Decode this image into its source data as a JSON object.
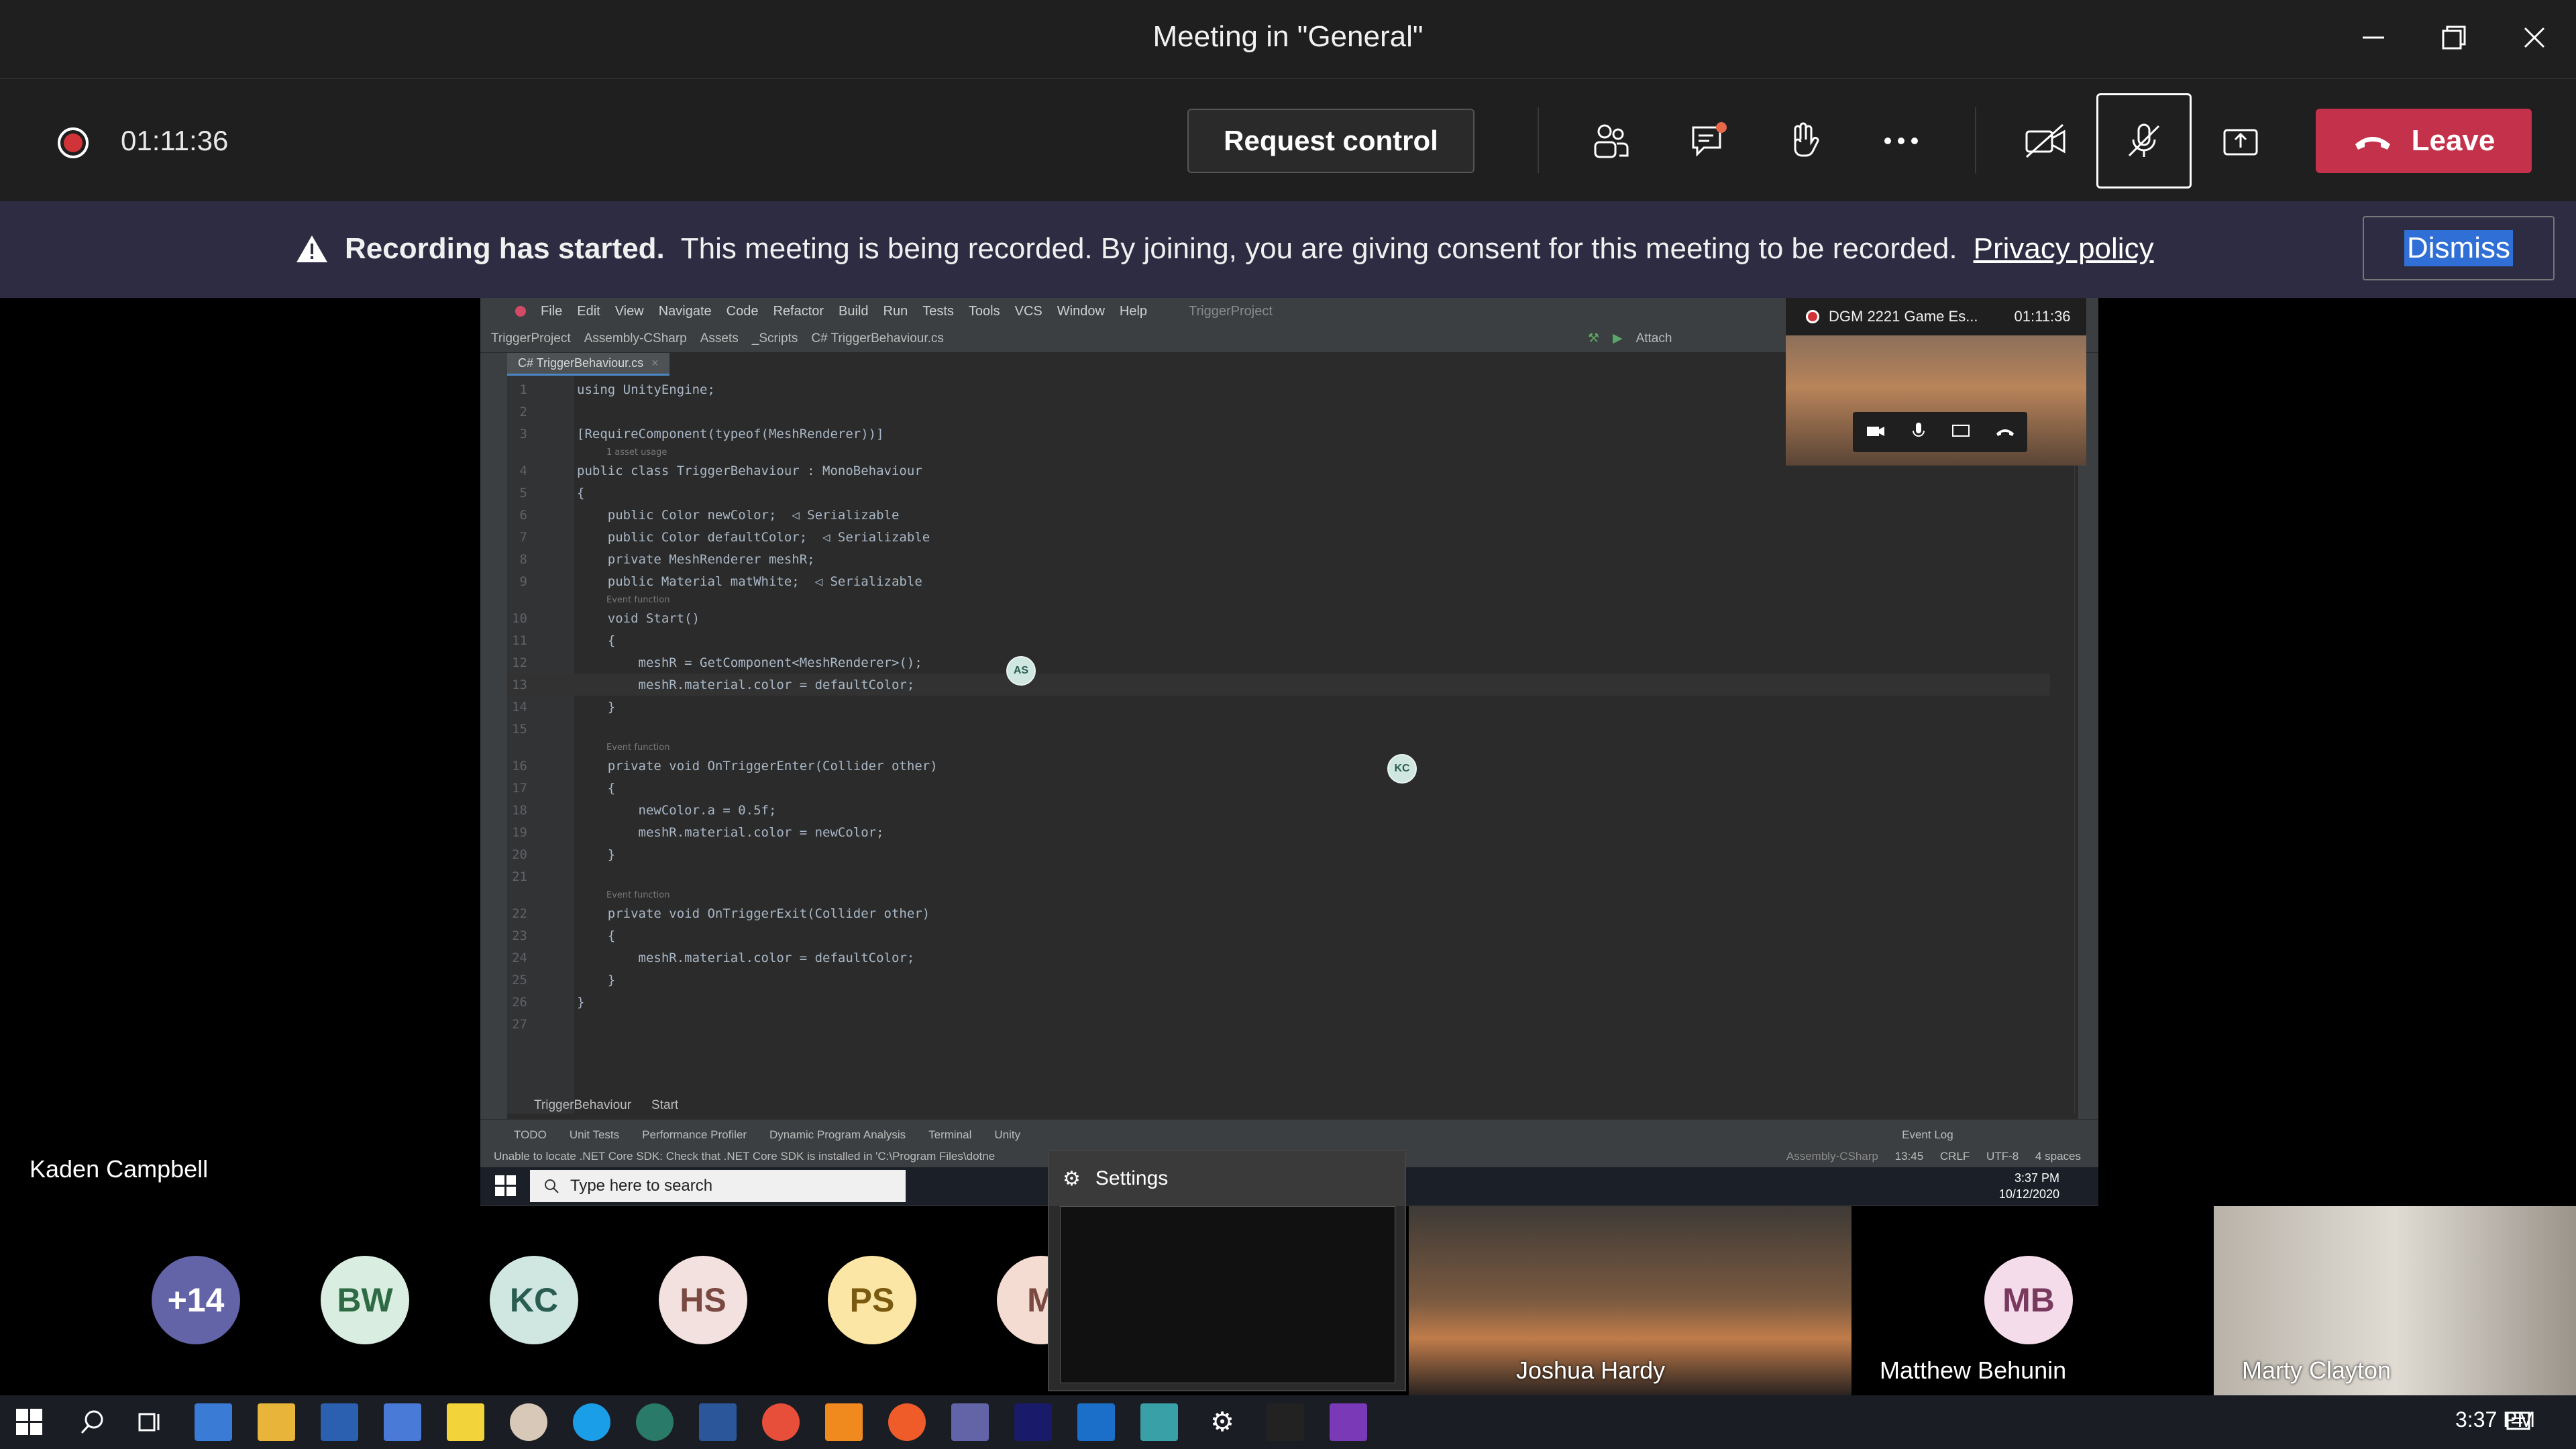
{
  "window": {
    "title": "Meeting in \"General\""
  },
  "toolbar": {
    "timer": "01:11:36",
    "request_control": "Request control",
    "leave": "Leave"
  },
  "banner": {
    "heading": "Recording has started.",
    "message": "This meeting is being recorded. By joining, you are giving consent for this meeting to be recorded.",
    "link": "Privacy policy",
    "dismiss": "Dismiss"
  },
  "ide": {
    "menu": [
      "File",
      "Edit",
      "View",
      "Navigate",
      "Code",
      "Refactor",
      "Build",
      "Run",
      "Tests",
      "Tools",
      "VCS",
      "Window",
      "Help"
    ],
    "project": "TriggerProject",
    "breadcrumb": [
      "TriggerProject",
      "Assembly-CSharp",
      "Assets",
      "_Scripts",
      "C# TriggerBehaviour.cs"
    ],
    "attach": "Attach",
    "tab": "C# TriggerBehaviour.cs",
    "code": [
      {
        "ln": "1",
        "text": "using UnityEngine;"
      },
      {
        "ln": "2",
        "text": ""
      },
      {
        "ln": "3",
        "text": "[RequireComponent(typeof(MeshRenderer))]"
      },
      {
        "hint": "1 asset usage"
      },
      {
        "ln": "4",
        "text": "public class TriggerBehaviour : MonoBehaviour"
      },
      {
        "ln": "5",
        "text": "{"
      },
      {
        "ln": "6",
        "text": "    public Color newColor;  ◁ Serializable"
      },
      {
        "ln": "7",
        "text": "    public Color defaultColor;  ◁ Serializable"
      },
      {
        "ln": "8",
        "text": "    private MeshRenderer meshR;"
      },
      {
        "ln": "9",
        "text": "    public Material matWhite;  ◁ Serializable"
      },
      {
        "hint": "Event function"
      },
      {
        "ln": "10",
        "text": "    void Start()"
      },
      {
        "ln": "11",
        "text": "    {"
      },
      {
        "ln": "12",
        "text": "        meshR = GetComponent<MeshRenderer>();"
      },
      {
        "ln": "13",
        "text": "        meshR.material.color = defaultColor;",
        "current": true
      },
      {
        "ln": "14",
        "text": "    }"
      },
      {
        "ln": "15",
        "text": ""
      },
      {
        "hint": "Event function"
      },
      {
        "ln": "16",
        "text": "    private void OnTriggerEnter(Collider other)"
      },
      {
        "ln": "17",
        "text": "    {"
      },
      {
        "ln": "18",
        "text": "        newColor.a = 0.5f;"
      },
      {
        "ln": "19",
        "text": "        meshR.material.color = newColor;"
      },
      {
        "ln": "20",
        "text": "    }"
      },
      {
        "ln": "21",
        "text": ""
      },
      {
        "hint": "Event function"
      },
      {
        "ln": "22",
        "text": "    private void OnTriggerExit(Collider other)"
      },
      {
        "ln": "23",
        "text": "    {"
      },
      {
        "ln": "24",
        "text": "        meshR.material.color = defaultColor;"
      },
      {
        "ln": "25",
        "text": "    }"
      },
      {
        "ln": "26",
        "text": "}"
      },
      {
        "ln": "27",
        "text": ""
      }
    ],
    "structure": [
      "TriggerBehaviour",
      "Start"
    ],
    "tool_tabs": [
      "TODO",
      "Unit Tests",
      "Performance Profiler",
      "Dynamic Program Analysis",
      "Terminal",
      "Unity"
    ],
    "event_log": "Event Log",
    "status": "Unable to locate .NET Core SDK: Check that .NET Core SDK is installed in 'C:\\Program Files\\dotne",
    "status_right": [
      "Assembly-CSharp",
      "13:45",
      "CRLF",
      "UTF-8",
      "4 spaces"
    ],
    "cursors": [
      "AS",
      "KC"
    ]
  },
  "mini_call": {
    "title": "DGM 2221 Game Es...",
    "timer": "01:11:36"
  },
  "inner_taskbar": {
    "search_placeholder": "Type here to search",
    "time": "3:37 PM",
    "date": "10/12/2020"
  },
  "settings_popup": {
    "title": "Settings"
  },
  "presenter": "Kaden Campbell",
  "gallery": {
    "avatars": [
      {
        "initials": "+14",
        "bg": "#6264a7",
        "fg": "#ffffff"
      },
      {
        "initials": "BW",
        "bg": "#d9eee0",
        "fg": "#2e6b45"
      },
      {
        "initials": "KC",
        "bg": "#cfe7e0",
        "fg": "#2a5d50"
      },
      {
        "initials": "HS",
        "bg": "#f2e1de",
        "fg": "#7a4a42"
      },
      {
        "initials": "PS",
        "bg": "#fbe6a6",
        "fg": "#7a5a10"
      },
      {
        "initials": "M",
        "bg": "#f5dcd2",
        "fg": "#7a4a42"
      }
    ],
    "tiles": [
      {
        "name": "Joshua Hardy"
      },
      {
        "name": "Matthew Behunin",
        "initials": "MB"
      },
      {
        "name": "Marty Clayton"
      }
    ]
  },
  "os_taskbar": {
    "time": "3:37 PM"
  },
  "colors": {
    "accent": "#6264a7",
    "leave": "#c4314b",
    "banner": "#2d2c42",
    "record": "#d13438"
  }
}
